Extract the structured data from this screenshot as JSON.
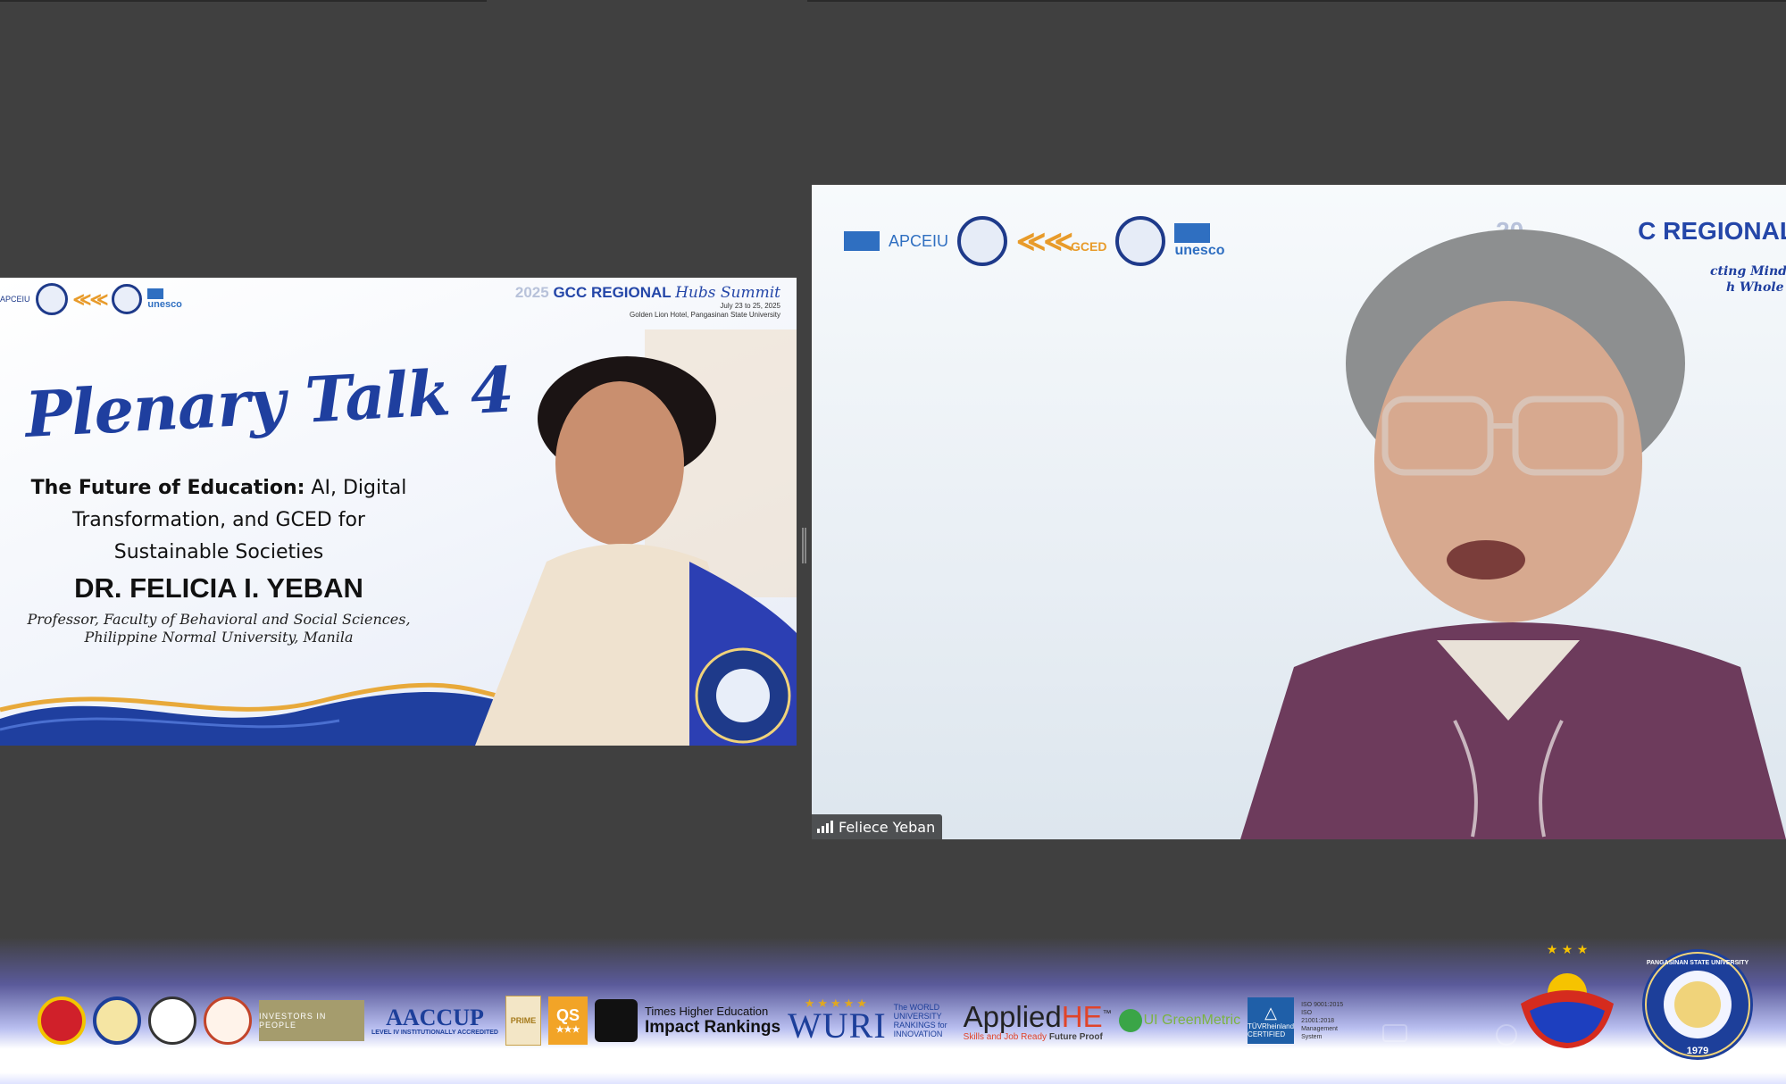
{
  "slide": {
    "org_left_text": "APCEIU",
    "unesco_word": "unesco",
    "event_year": "2025",
    "event_title": "GCC REGIONAL",
    "event_hubs": "Hubs Summit",
    "event_dates": "July 23 to 25, 2025",
    "event_venue": "Golden Lion Hotel, Pangasinan State University",
    "plenary": "Plenary Talk 4",
    "talk_title_bold": "The Future of Education:",
    "talk_title_rest_1": " AI, Digital",
    "talk_title_line_2": "Transformation, and GCED for",
    "talk_title_line_3": "Sustainable Societies",
    "speaker_name": "DR. FELICIA I. YEBAN",
    "speaker_role_1": "Professor, Faculty of Behavioral and Social Sciences,",
    "speaker_role_2": "Philippine Normal University, Manila"
  },
  "video": {
    "apceiu": "APCEIU",
    "gced": "GCED",
    "unesco_word": "unesco",
    "event_title_visible": "20",
    "event_title_visible_2": "C REGIONAL",
    "event_sub_1": "cting Minds",
    "event_sub_2": "h Whole S",
    "participant_name": "Feliece Yeban"
  },
  "banner": {
    "investors": "INVESTORS IN PEOPLE",
    "aaccup": "AACCUP",
    "aaccup_sub": "LEVEL IV INSTITUTIONALLY ACCREDITED",
    "prime": "PRIME",
    "qs": "QS",
    "qs_stars": "★★★",
    "the_line1": "Times Higher Education",
    "the_line2": "Impact Rankings",
    "wuri_stars": "★★★★★",
    "wuri": "WURI",
    "wuri_sub": "The WORLD UNIVERSITY RANKINGS for INNOVATION",
    "applied": "Applied",
    "applied_he": "HE",
    "applied_tm": "™",
    "applied_tag_1": "Skills and Job Ready",
    "applied_tag_2": "Future Proof",
    "greenmetric": "UI GreenMetric",
    "tuv": "TÜVRheinland CERTIFIED",
    "iso": "ISO 9001:2015 ISO 21001:2018 Management System",
    "bagong_pilipinas": "BAGONG PILIPINAS",
    "psu_seal_text": "PANGASINAN STATE UNIVERSITY",
    "psu_year": "1979"
  },
  "colors": {
    "background": "#404040",
    "brand_blue": "#2446a8",
    "accent_gold": "#e89b2a"
  }
}
